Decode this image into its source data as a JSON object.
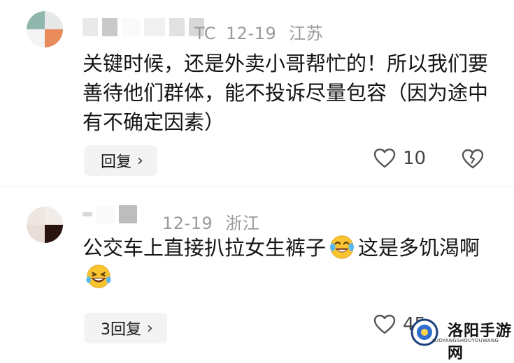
{
  "comments": [
    {
      "time_suffix": "TC",
      "date": "12-19",
      "location": "江苏",
      "text": "关键时候，还是外卖小哥帮忙的！所以我们要善待他们群体，能不投诉尽量包容（因为途中有不确定因素）",
      "reply_label": "回复",
      "likes": "10",
      "avatar_colors": [
        "#8fb7ad",
        "#e7e9e8",
        "#f4f4f4",
        "#e98a5b"
      ]
    },
    {
      "date": "12-19",
      "location": "浙江",
      "text_part1": "公交车上直接扒拉女生裤子",
      "text_part2": "这是多饥渴啊",
      "reply_label": "3回复",
      "likes": "45",
      "avatar_colors": [
        "#efe6e2",
        "#f2ece9",
        "#e9ddd8",
        "#2a1410"
      ]
    }
  ],
  "icons": {
    "chevron": "chevron-right-icon",
    "heart": "heart-outline-icon",
    "broken_heart": "broken-heart-icon",
    "emoji_cry_laugh": "face-with-tears-of-joy-icon",
    "emoji_laugh": "grinning-squinting-face-icon"
  },
  "watermark": {
    "title": "洛阳手游网",
    "subtitle": "LUOYANGSHOUYOUWANG"
  }
}
